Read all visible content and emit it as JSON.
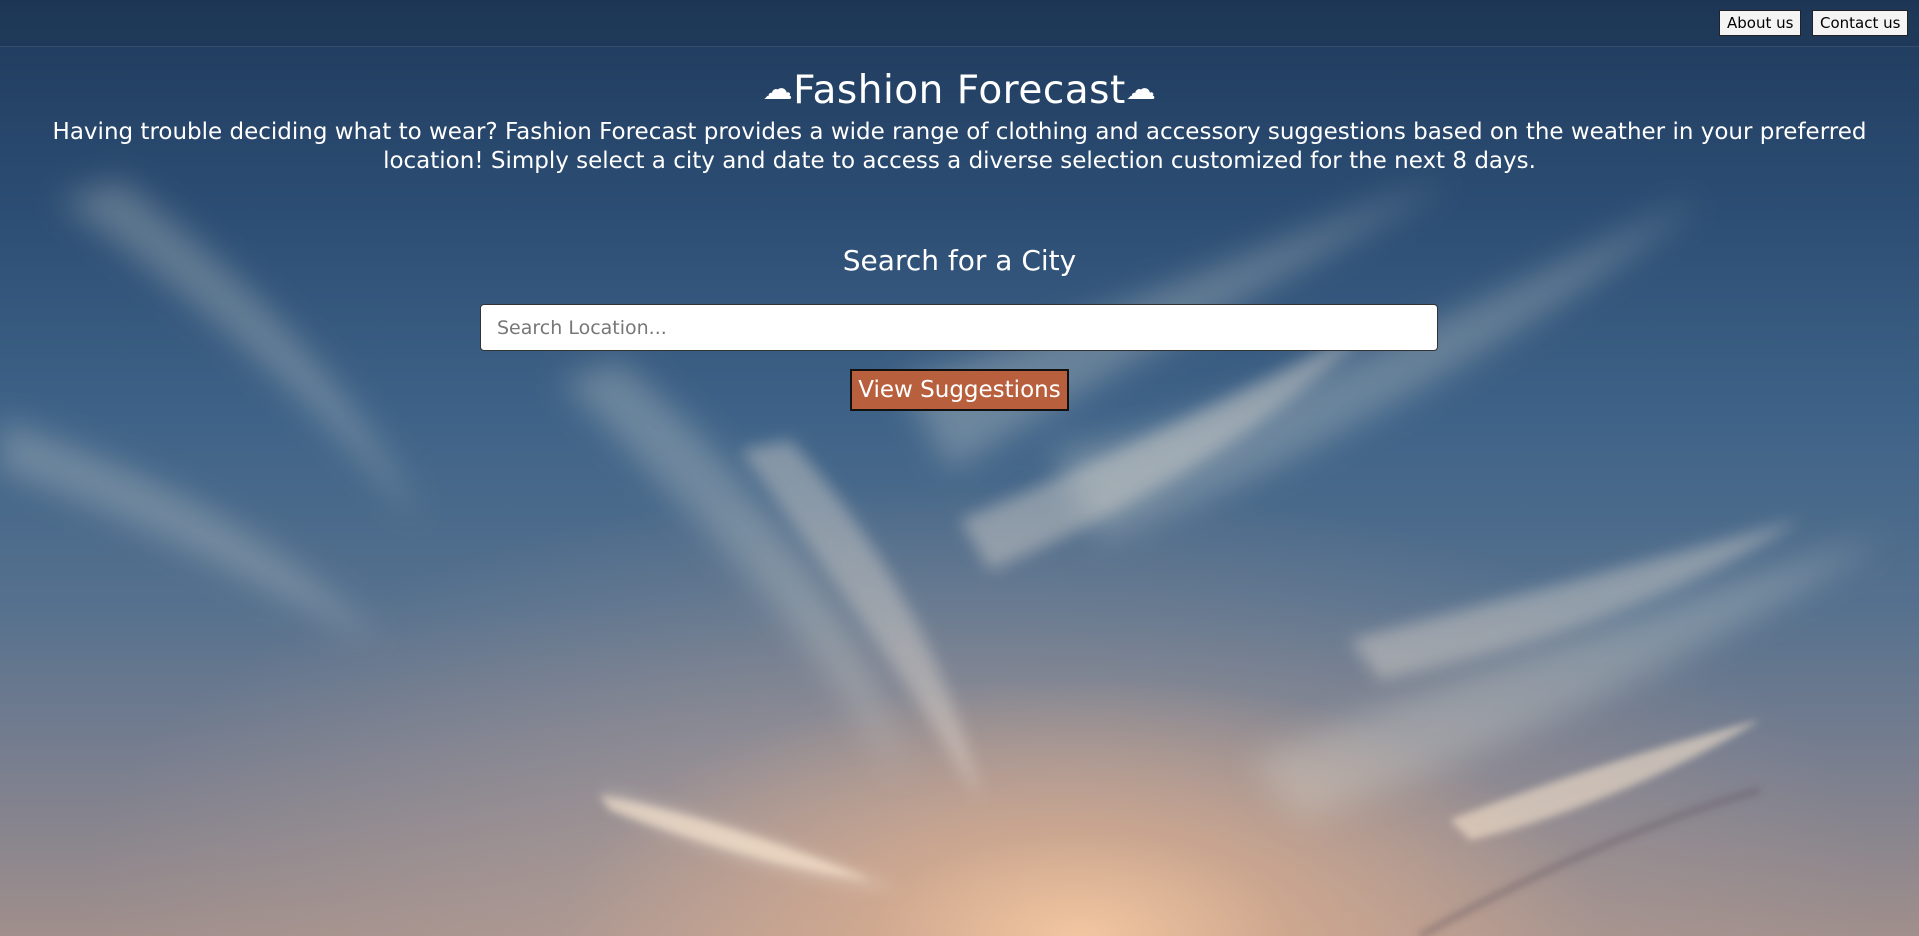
{
  "nav": {
    "about_label": "About us",
    "contact_label": "Contact us"
  },
  "header": {
    "title_icon": "cloud-icon",
    "title_icon_glyph": "☁",
    "title": "Fashion Forecast",
    "description": "Having trouble deciding what to wear? Fashion Forecast provides a wide range of clothing and accessory suggestions based on the weather in your preferred location! Simply select a city and date to access a diverse selection customized for the next 8 days."
  },
  "search": {
    "heading": "Search for a City",
    "placeholder": "Search Location...",
    "value": "",
    "button_label": "View Suggestions"
  },
  "colors": {
    "accent_button": "#b8603e",
    "text": "#ffffff",
    "sky_top": "#1f3a5c",
    "sky_glow": "#f5c8a0"
  }
}
